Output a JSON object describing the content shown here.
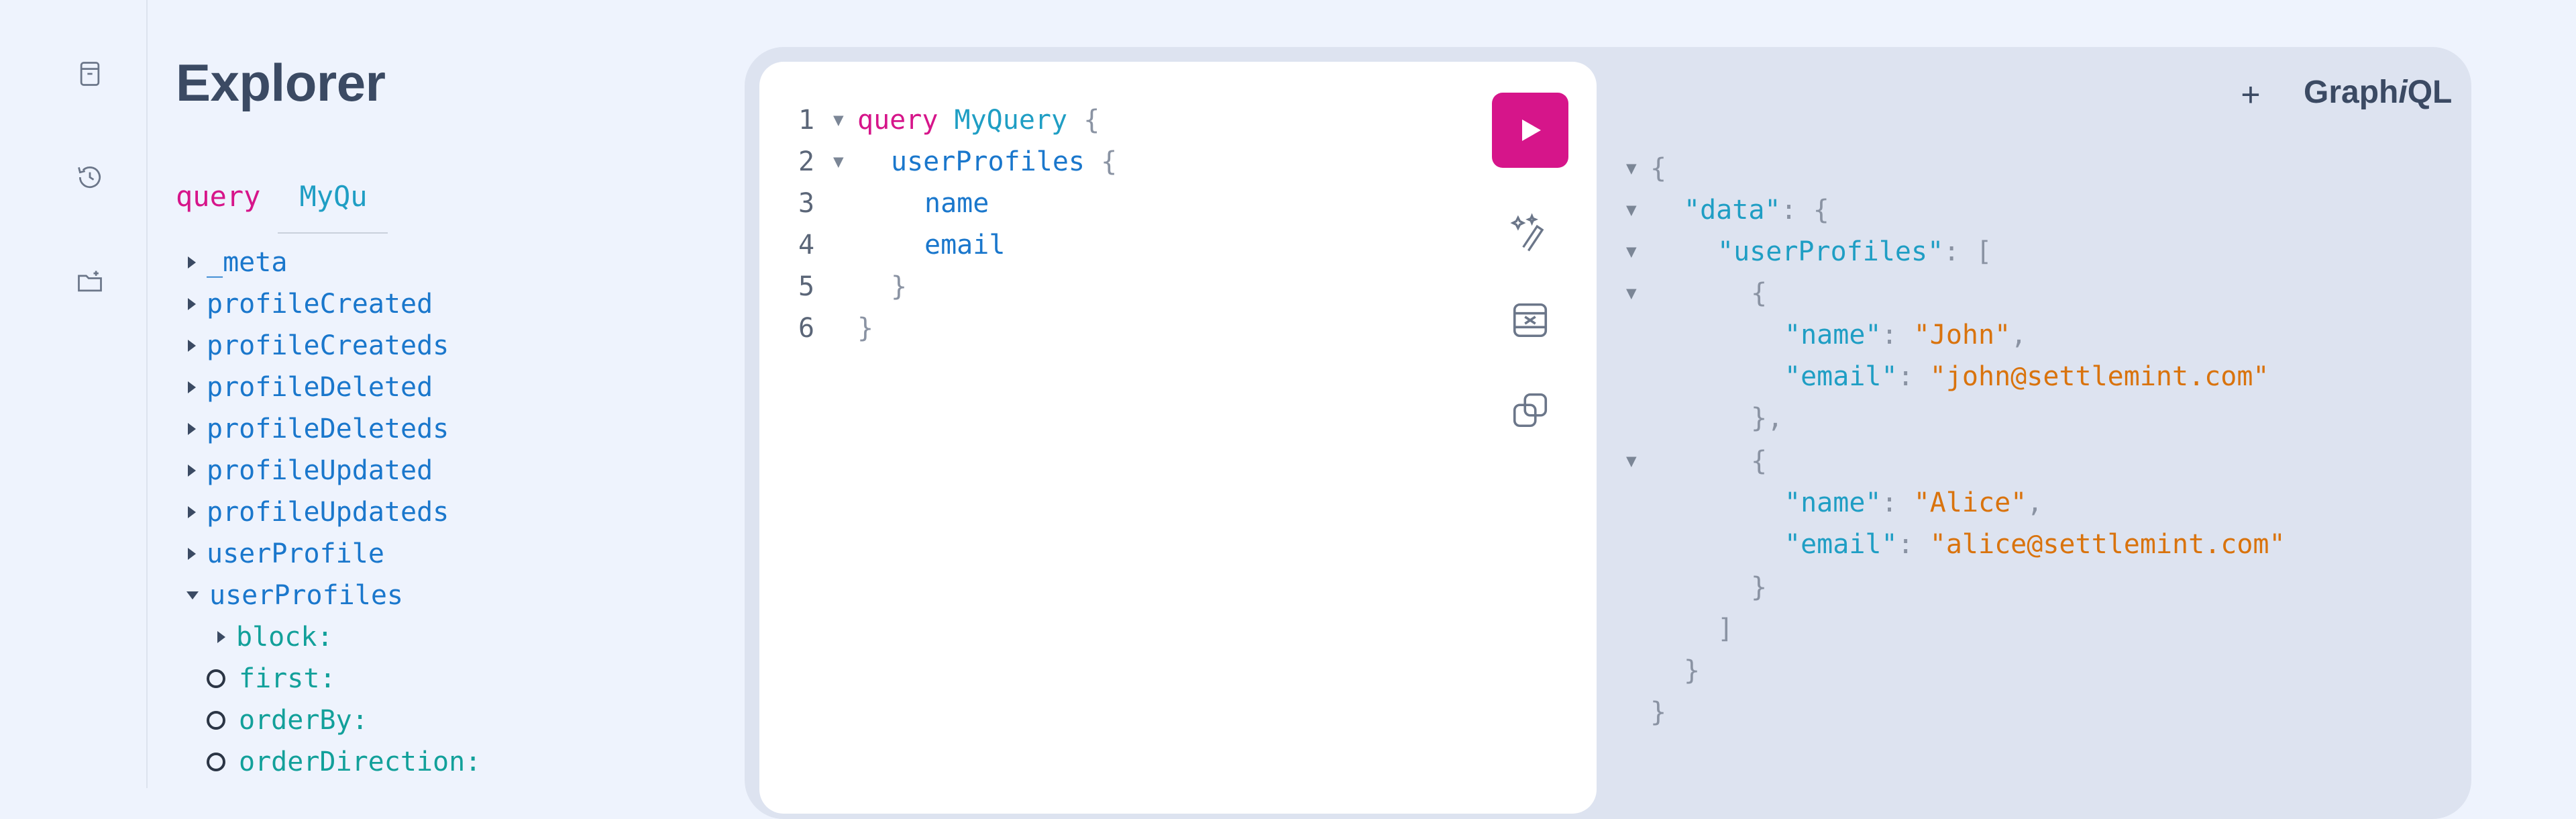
{
  "explorer": {
    "title": "Explorer",
    "op_kind": "query",
    "op_name": "MyQuery",
    "fields": [
      "_meta",
      "profileCreated",
      "profileCreateds",
      "profileDeleted",
      "profileDeleteds",
      "profileUpdated",
      "profileUpdateds",
      "userProfile",
      "userProfiles"
    ],
    "args": [
      "block:",
      "first:",
      "orderBy:",
      "orderDirection:"
    ]
  },
  "editor": {
    "line_numbers": [
      "1",
      "2",
      "3",
      "4",
      "5",
      "6"
    ],
    "l1_kw": "query",
    "l1_name": "MyQuery",
    "open_brace": "{",
    "close_brace": "}",
    "l2_field": "userProfiles",
    "l3_field": "name",
    "l4_field": "email"
  },
  "toolbar": {
    "add_tab": "+",
    "logo_a": "Graph",
    "logo_b": "i",
    "logo_c": "QL"
  },
  "result": {
    "open_brace": "{",
    "close_brace": "}",
    "open_bracket": "[",
    "close_bracket": "]",
    "colon": ":",
    "comma": ",",
    "brace_comma": "},",
    "key_data": "\"data\"",
    "key_userProfiles": "\"userProfiles\"",
    "key_name": "\"name\"",
    "key_email": "\"email\"",
    "name1": "\"John\"",
    "email1": "\"john@settlemint.com\"",
    "name2": "\"Alice\"",
    "email2": "\"alice@settlemint.com\""
  },
  "icons": {
    "docs": "book-icon",
    "history": "history-icon",
    "collections": "folder-plus-icon",
    "run": "play-icon",
    "prettify": "magic-wand-icon",
    "merge": "merge-fragments-icon",
    "copy": "copy-icon"
  },
  "colors": {
    "accent": "#d6158a",
    "keyword": "#d6158a",
    "string": "#d9730d",
    "property": "#1a77cc",
    "definition": "#1f9ec4",
    "argument": "#12a09a"
  }
}
